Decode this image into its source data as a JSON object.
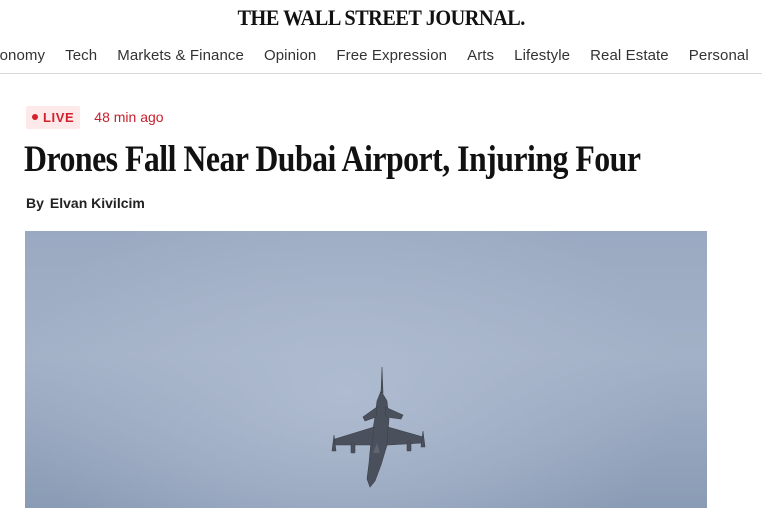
{
  "masthead": {
    "title": "THE WALL STREET JOURNAL."
  },
  "nav": {
    "items": [
      {
        "label": "conomy"
      },
      {
        "label": "Tech"
      },
      {
        "label": "Markets & Finance"
      },
      {
        "label": "Opinion"
      },
      {
        "label": "Free Expression"
      },
      {
        "label": "Arts"
      },
      {
        "label": "Lifestyle"
      },
      {
        "label": "Real Estate"
      },
      {
        "label": "Personal"
      }
    ]
  },
  "article": {
    "live_label": "LIVE",
    "time_ago": "48 min ago",
    "headline": "Drones Fall Near Dubai Airport, Injuring Four",
    "byline_prefix": "By",
    "author": "Elvan Kivilcim"
  },
  "colors": {
    "accent_red": "#d4202c",
    "sky": "#a3b1c7"
  }
}
